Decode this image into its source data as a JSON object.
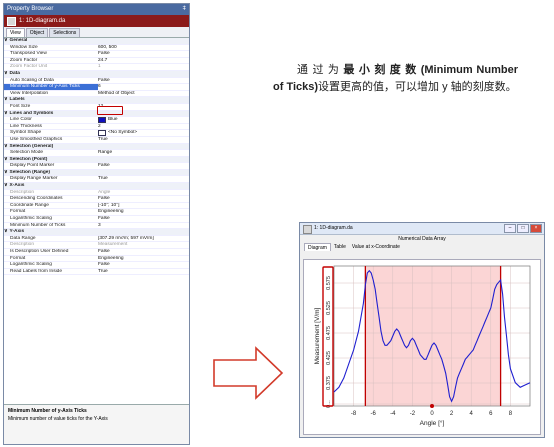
{
  "property_browser": {
    "title": "Property Browser",
    "pin": "ǂ",
    "document": "1: 1D-diagram.da",
    "tabs": [
      "View",
      "Object",
      "Selections"
    ],
    "rows": [
      {
        "type": "cat",
        "k": "General"
      },
      {
        "k": "Window Size",
        "v": "600, 500"
      },
      {
        "k": "Transposed View",
        "v": "False"
      },
      {
        "k": "Zoom Factor",
        "v": "24.7"
      },
      {
        "k": "Zoom Factor Unit",
        "v": "1",
        "dim": true
      },
      {
        "type": "cat",
        "k": "Data"
      },
      {
        "k": "Auto Scaling of Data",
        "v": "False"
      },
      {
        "k": "Minimum Number of y-Axis Ticks",
        "v": "6",
        "sel": true
      },
      {
        "k": "View Interpolation",
        "v": "Method of Object"
      },
      {
        "type": "cat",
        "k": "Labels"
      },
      {
        "k": "Font Size",
        "v": "12"
      },
      {
        "type": "cat",
        "k": "Lines and Symbols"
      },
      {
        "k": "Line Color",
        "v": "Blue",
        "swatch": "blue"
      },
      {
        "k": "Line Thickness",
        "v": "2"
      },
      {
        "k": "Symbol Shape",
        "v": "<No Symbol>",
        "swatch": "white"
      },
      {
        "k": "Use Smoothed Graphics",
        "v": "True"
      },
      {
        "type": "cat",
        "k": "Selection (General)"
      },
      {
        "k": "Selection Mode",
        "v": "Range"
      },
      {
        "type": "cat",
        "k": "Selection (Point)"
      },
      {
        "k": "Display Point Marker",
        "v": "False"
      },
      {
        "type": "cat",
        "k": "Selection (Range)"
      },
      {
        "k": "Display Range Marker",
        "v": "True"
      },
      {
        "type": "cat",
        "k": "X-Axis"
      },
      {
        "k": "Description",
        "v": "Angle",
        "dim": true
      },
      {
        "k": "Descending Coordinates",
        "v": "False"
      },
      {
        "k": "Coordinate Range",
        "v": "[-10°; 10°]"
      },
      {
        "k": "Format",
        "v": "Engineering"
      },
      {
        "k": "Logarithmic Scaling",
        "v": "False"
      },
      {
        "k": "Minimum Number of Ticks",
        "v": "3"
      },
      {
        "type": "cat",
        "k": "Y-Axis"
      },
      {
        "k": "Data Range",
        "v": "[307.29 mV/m; 597 mV/m]"
      },
      {
        "k": "Description",
        "v": "Measurement",
        "dim": true
      },
      {
        "k": "Is Description User Defined",
        "v": "False"
      },
      {
        "k": "Format",
        "v": "Engineering"
      },
      {
        "k": "Logarithmic Scaling",
        "v": "False"
      },
      {
        "k": "Read Labels from Inside",
        "v": "True"
      }
    ],
    "help_title": "Minimum Number of y-Axis Ticks",
    "help_text": "Minimum number of value ticks for the Y-Axis"
  },
  "description": {
    "pre": "通 过 为 ",
    "bold": "最 小 刻 度 数 (Minimum Number of Ticks)",
    "post": "设置更高的值，可以增加 y 轴的刻度数。"
  },
  "diagram_window": {
    "title": "1: 1D-diagram.da",
    "subtitle": "Numerical Data Array",
    "buttons": [
      "–",
      "□",
      "×"
    ],
    "tabs": [
      "Diagram",
      "Table",
      "Value at x-Coordinate"
    ]
  },
  "chart_data": {
    "type": "line",
    "xlabel": "Angle [°]",
    "ylabel": "Measurement [V/m]",
    "xlim": [
      -10,
      10
    ],
    "ylim": [
      0.3,
      0.6
    ],
    "x_ticks": [
      -8,
      -6,
      -4,
      -2,
      0,
      2,
      4,
      6,
      8
    ],
    "y_ticks": [
      0,
      0.375,
      0.425,
      0.475,
      0.525,
      0.575
    ],
    "y_tick_labels": [
      "0...",
      "0.375",
      "0.425",
      "0.475",
      "0.525",
      "0.575"
    ],
    "selection_range": [
      -6.8,
      7.0
    ],
    "series": [
      {
        "color": "#1f1fd0",
        "x": [
          -10,
          -9.5,
          -9,
          -8.5,
          -8,
          -7.5,
          -7,
          -6.8,
          -6.6,
          -6.4,
          -6.2,
          -6,
          -5.8,
          -5.6,
          -5.4,
          -5.2,
          -5,
          -4.8,
          -4.6,
          -4.4,
          -4.2,
          -4,
          -3.8,
          -3.6,
          -3.4,
          -3.2,
          -3,
          -2.8,
          -2.6,
          -2.4,
          -2.2,
          -2,
          -1.8,
          -1.6,
          -1.4,
          -1.2,
          -1,
          -0.8,
          -0.6,
          -0.4,
          -0.2,
          0,
          0.2,
          0.4,
          0.6,
          0.8,
          1,
          1.2,
          1.4,
          1.6,
          1.8,
          2,
          2.2,
          2.4,
          2.6,
          2.8,
          3,
          3.2,
          3.4,
          3.6,
          3.8,
          4,
          4.2,
          4.4,
          4.6,
          4.8,
          5,
          5.2,
          5.4,
          5.6,
          5.8,
          6,
          6.2,
          6.4,
          6.6,
          6.8,
          7,
          7.2,
          7.4,
          7.6,
          7.8,
          8,
          8.5,
          9,
          9.5,
          10
        ],
        "y": [
          0.33,
          0.34,
          0.36,
          0.39,
          0.42,
          0.46,
          0.52,
          0.56,
          0.585,
          0.59,
          0.585,
          0.57,
          0.55,
          0.52,
          0.49,
          0.46,
          0.44,
          0.43,
          0.43,
          0.435,
          0.44,
          0.45,
          0.46,
          0.465,
          0.46,
          0.45,
          0.44,
          0.43,
          0.425,
          0.43,
          0.44,
          0.445,
          0.44,
          0.43,
          0.42,
          0.41,
          0.405,
          0.4,
          0.4,
          0.41,
          0.42,
          0.43,
          0.435,
          0.43,
          0.42,
          0.41,
          0.4,
          0.385,
          0.37,
          0.345,
          0.32,
          0.31,
          0.32,
          0.34,
          0.36,
          0.37,
          0.38,
          0.39,
          0.4,
          0.405,
          0.41,
          0.415,
          0.42,
          0.43,
          0.44,
          0.45,
          0.46,
          0.47,
          0.48,
          0.49,
          0.5,
          0.51,
          0.53,
          0.55,
          0.56,
          0.565,
          0.57,
          0.54,
          0.49,
          0.45,
          0.41,
          0.38,
          0.35,
          0.34,
          0.345,
          0.35
        ]
      }
    ]
  }
}
